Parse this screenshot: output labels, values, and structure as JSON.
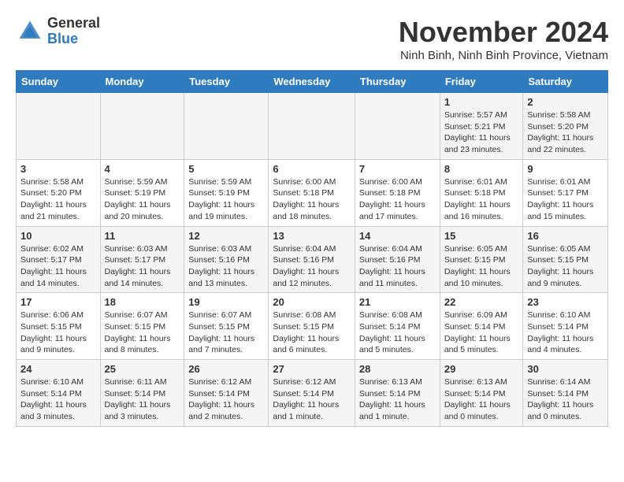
{
  "header": {
    "logo_general": "General",
    "logo_blue": "Blue",
    "month_title": "November 2024",
    "location": "Ninh Binh, Ninh Binh Province, Vietnam"
  },
  "days_of_week": [
    "Sunday",
    "Monday",
    "Tuesday",
    "Wednesday",
    "Thursday",
    "Friday",
    "Saturday"
  ],
  "weeks": [
    {
      "days": [
        {
          "num": "",
          "info": ""
        },
        {
          "num": "",
          "info": ""
        },
        {
          "num": "",
          "info": ""
        },
        {
          "num": "",
          "info": ""
        },
        {
          "num": "",
          "info": ""
        },
        {
          "num": "1",
          "info": "Sunrise: 5:57 AM\nSunset: 5:21 PM\nDaylight: 11 hours\nand 23 minutes."
        },
        {
          "num": "2",
          "info": "Sunrise: 5:58 AM\nSunset: 5:20 PM\nDaylight: 11 hours\nand 22 minutes."
        }
      ]
    },
    {
      "days": [
        {
          "num": "3",
          "info": "Sunrise: 5:58 AM\nSunset: 5:20 PM\nDaylight: 11 hours\nand 21 minutes."
        },
        {
          "num": "4",
          "info": "Sunrise: 5:59 AM\nSunset: 5:19 PM\nDaylight: 11 hours\nand 20 minutes."
        },
        {
          "num": "5",
          "info": "Sunrise: 5:59 AM\nSunset: 5:19 PM\nDaylight: 11 hours\nand 19 minutes."
        },
        {
          "num": "6",
          "info": "Sunrise: 6:00 AM\nSunset: 5:18 PM\nDaylight: 11 hours\nand 18 minutes."
        },
        {
          "num": "7",
          "info": "Sunrise: 6:00 AM\nSunset: 5:18 PM\nDaylight: 11 hours\nand 17 minutes."
        },
        {
          "num": "8",
          "info": "Sunrise: 6:01 AM\nSunset: 5:18 PM\nDaylight: 11 hours\nand 16 minutes."
        },
        {
          "num": "9",
          "info": "Sunrise: 6:01 AM\nSunset: 5:17 PM\nDaylight: 11 hours\nand 15 minutes."
        }
      ]
    },
    {
      "days": [
        {
          "num": "10",
          "info": "Sunrise: 6:02 AM\nSunset: 5:17 PM\nDaylight: 11 hours\nand 14 minutes."
        },
        {
          "num": "11",
          "info": "Sunrise: 6:03 AM\nSunset: 5:17 PM\nDaylight: 11 hours\nand 14 minutes."
        },
        {
          "num": "12",
          "info": "Sunrise: 6:03 AM\nSunset: 5:16 PM\nDaylight: 11 hours\nand 13 minutes."
        },
        {
          "num": "13",
          "info": "Sunrise: 6:04 AM\nSunset: 5:16 PM\nDaylight: 11 hours\nand 12 minutes."
        },
        {
          "num": "14",
          "info": "Sunrise: 6:04 AM\nSunset: 5:16 PM\nDaylight: 11 hours\nand 11 minutes."
        },
        {
          "num": "15",
          "info": "Sunrise: 6:05 AM\nSunset: 5:15 PM\nDaylight: 11 hours\nand 10 minutes."
        },
        {
          "num": "16",
          "info": "Sunrise: 6:05 AM\nSunset: 5:15 PM\nDaylight: 11 hours\nand 9 minutes."
        }
      ]
    },
    {
      "days": [
        {
          "num": "17",
          "info": "Sunrise: 6:06 AM\nSunset: 5:15 PM\nDaylight: 11 hours\nand 9 minutes."
        },
        {
          "num": "18",
          "info": "Sunrise: 6:07 AM\nSunset: 5:15 PM\nDaylight: 11 hours\nand 8 minutes."
        },
        {
          "num": "19",
          "info": "Sunrise: 6:07 AM\nSunset: 5:15 PM\nDaylight: 11 hours\nand 7 minutes."
        },
        {
          "num": "20",
          "info": "Sunrise: 6:08 AM\nSunset: 5:15 PM\nDaylight: 11 hours\nand 6 minutes."
        },
        {
          "num": "21",
          "info": "Sunrise: 6:08 AM\nSunset: 5:14 PM\nDaylight: 11 hours\nand 5 minutes."
        },
        {
          "num": "22",
          "info": "Sunrise: 6:09 AM\nSunset: 5:14 PM\nDaylight: 11 hours\nand 5 minutes."
        },
        {
          "num": "23",
          "info": "Sunrise: 6:10 AM\nSunset: 5:14 PM\nDaylight: 11 hours\nand 4 minutes."
        }
      ]
    },
    {
      "days": [
        {
          "num": "24",
          "info": "Sunrise: 6:10 AM\nSunset: 5:14 PM\nDaylight: 11 hours\nand 3 minutes."
        },
        {
          "num": "25",
          "info": "Sunrise: 6:11 AM\nSunset: 5:14 PM\nDaylight: 11 hours\nand 3 minutes."
        },
        {
          "num": "26",
          "info": "Sunrise: 6:12 AM\nSunset: 5:14 PM\nDaylight: 11 hours\nand 2 minutes."
        },
        {
          "num": "27",
          "info": "Sunrise: 6:12 AM\nSunset: 5:14 PM\nDaylight: 11 hours\nand 1 minute."
        },
        {
          "num": "28",
          "info": "Sunrise: 6:13 AM\nSunset: 5:14 PM\nDaylight: 11 hours\nand 1 minute."
        },
        {
          "num": "29",
          "info": "Sunrise: 6:13 AM\nSunset: 5:14 PM\nDaylight: 11 hours\nand 0 minutes."
        },
        {
          "num": "30",
          "info": "Sunrise: 6:14 AM\nSunset: 5:14 PM\nDaylight: 11 hours\nand 0 minutes."
        }
      ]
    }
  ]
}
